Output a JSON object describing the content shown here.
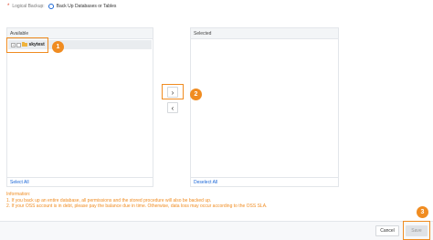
{
  "backup": {
    "required_mark": "*",
    "label": "Logical Backup:",
    "option_label": "Back Up Databases or Tables"
  },
  "available_panel": {
    "header": "Available",
    "items": [
      {
        "expander": "+",
        "name": "skytest"
      }
    ],
    "footer_action": "Select All"
  },
  "selected_panel": {
    "header": "Selected",
    "footer_action": "Deselect All"
  },
  "move_buttons": {
    "right_glyph": "›",
    "left_glyph": "‹"
  },
  "badges": {
    "one": "1",
    "two": "2",
    "three": "3"
  },
  "information": {
    "title": "Information:",
    "line1": "1. If you back up an entire database, all permissions and the stored procedure will also be backed up.",
    "line2": "2. If your OSS account is in debt, please pay the balance due in time. Otherwise, data loss may occur according to the OSS SLA."
  },
  "footer": {
    "cancel_label": "Cancel",
    "save_label": "Save"
  },
  "colors": {
    "accent_orange": "#f08c21",
    "link_blue": "#1a66d6"
  }
}
